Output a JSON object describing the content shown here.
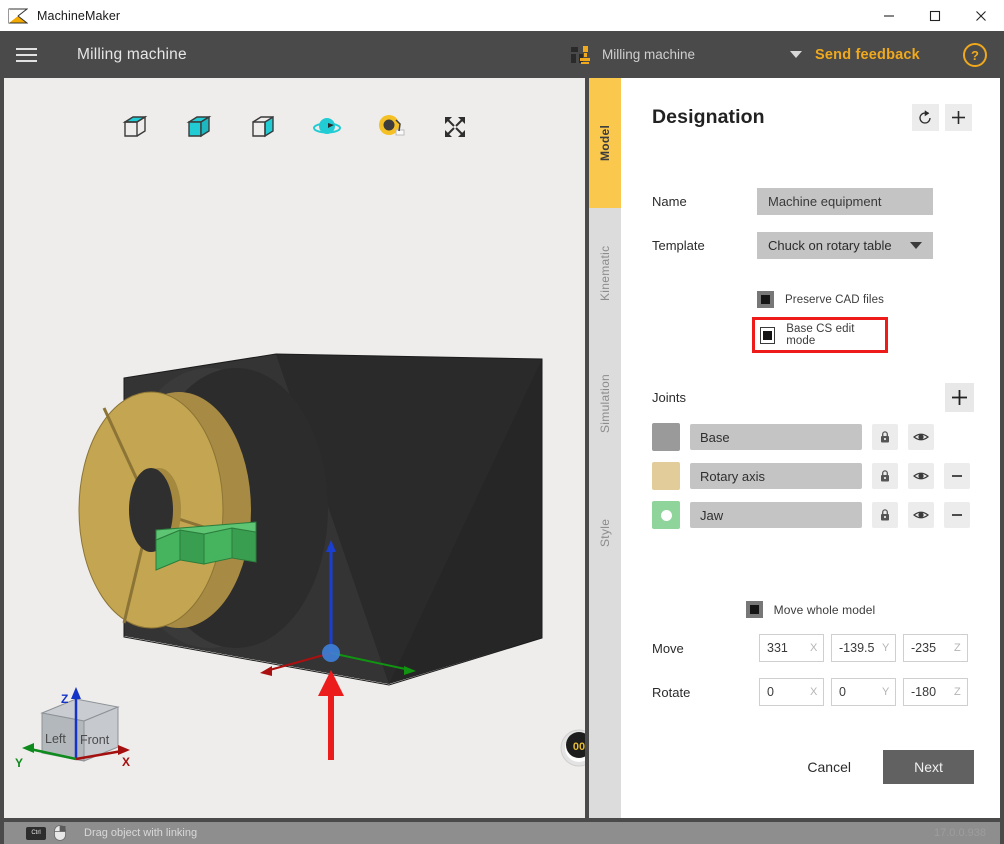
{
  "window": {
    "app_icon": "machinemaker-logo-icon",
    "title": "MachineMaker",
    "minimize": "minimize-icon",
    "maximize": "maximize-icon",
    "close": "close-icon"
  },
  "appbar": {
    "menu_icon": "hamburger-menu-icon",
    "title": "Milling machine",
    "machine_icon": "machine-icon",
    "machine_selector": "Milling machine",
    "dropdown_icon": "chevron-down-icon",
    "feedback": "Send feedback",
    "help": "?",
    "accent_color": "#f0a91c"
  },
  "viewport": {
    "tools": [
      {
        "name": "view-top-face-icon",
        "label": "Top face"
      },
      {
        "name": "view-whole-cube-icon",
        "label": "Whole body"
      },
      {
        "name": "view-side-face-icon",
        "label": "Side face"
      },
      {
        "name": "orbit-rotate-icon",
        "label": "Rotate"
      },
      {
        "name": "measure-tape-icon",
        "label": "Measure"
      },
      {
        "name": "fit-to-screen-icon",
        "label": "Fit to screen"
      }
    ],
    "nav_cube": {
      "face_left": "Left",
      "face_front": "Front",
      "axis_x": "X",
      "axis_y": "Y",
      "axis_z": "Z"
    },
    "angle_indicator": "00",
    "annotation": "red-arrow-pointing-to-origin"
  },
  "tabs": [
    {
      "label": "Model",
      "active": true
    },
    {
      "label": "Kinematic",
      "active": false
    },
    {
      "label": "Simulation",
      "active": false
    },
    {
      "label": "Style",
      "active": false
    }
  ],
  "panel": {
    "title": "Designation",
    "reset_icon": "undo-reset-icon",
    "add_icon": "plus-icon",
    "fields": [
      {
        "label": "Name",
        "value": "Machine equipment",
        "type": "text"
      },
      {
        "label": "Template",
        "value": "Chuck on rotary table",
        "type": "select"
      }
    ],
    "checkboxes": [
      {
        "label": "Preserve CAD files",
        "checked": true,
        "highlighted": false
      },
      {
        "label": "Base CS edit mode",
        "checked": true,
        "highlighted": true
      }
    ],
    "joints": {
      "title": "Joints",
      "add_icon": "plus-icon",
      "rows": [
        {
          "name": "Base",
          "color": "#9a9a9a",
          "dot": false,
          "lock_icon": "lock-icon",
          "eye_icon": "eye-icon",
          "remove_icon": "",
          "removable": false
        },
        {
          "name": "Rotary axis",
          "color": "#e2cd9a",
          "dot": false,
          "lock_icon": "lock-icon",
          "eye_icon": "eye-icon",
          "remove_icon": "−",
          "removable": true
        },
        {
          "name": "Jaw",
          "color": "#8fd49a",
          "dot": true,
          "lock_icon": "lock-icon",
          "eye_icon": "eye-icon",
          "remove_icon": "−",
          "removable": true
        }
      ]
    },
    "move_whole_model": {
      "label": "Move whole model",
      "checked": true
    },
    "transform": {
      "move": {
        "label": "Move",
        "x": "331",
        "y": "-139.5",
        "z": "-235",
        "axis_x": "X",
        "axis_y": "Y",
        "axis_z": "Z"
      },
      "rotate": {
        "label": "Rotate",
        "x": "0",
        "y": "0",
        "z": "-180",
        "axis_x": "X",
        "axis_y": "Y",
        "axis_z": "Z"
      }
    },
    "cancel": "Cancel",
    "next": "Next"
  },
  "statusbar": {
    "key_hint": "Ctrl",
    "mouse_icon": "mouse-icon",
    "hint": "Drag object with linking",
    "version": "17.0.0.938"
  },
  "colors": {
    "accent": "#f0a91c",
    "tab_active": "#fbc84e",
    "highlight_border": "#ee1b1b",
    "panel_bg": "#ffffff",
    "chrome_bg": "#4a4a4a",
    "viewport_bg": "#eeedeb",
    "model_body": "#2b2b2b",
    "model_chuck": "#c3a24f",
    "model_jaw": "#3faa5a"
  }
}
